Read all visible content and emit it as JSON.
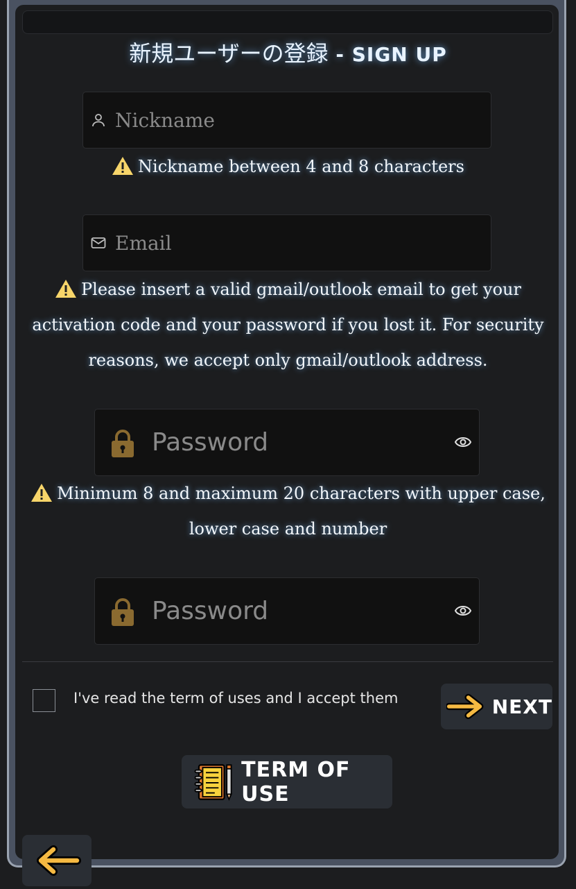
{
  "header": {
    "title_jp": "新規ユーザーの登録",
    "title_sep": " - ",
    "title_en": "SIGN UP"
  },
  "nickname": {
    "placeholder": "Nickname",
    "icon": "user-icon",
    "warning": "Nickname between 4 and 8 characters"
  },
  "email": {
    "placeholder": "Email",
    "icon": "mail-icon",
    "warning_line1": "Please insert a valid gmail/outlook email to get your",
    "warning_line2": "activation code and your password if you lost it. For security",
    "warning_line3": "reasons, we accept only gmail/outlook address."
  },
  "password": {
    "placeholder": "Password",
    "icon": "lock-icon",
    "toggle_icon": "eye-icon",
    "warning_line1": "Minimum 8 and maximum 20 characters with upper case,",
    "warning_line2": "lower case and number"
  },
  "password_confirm": {
    "placeholder": "Password",
    "icon": "lock-icon",
    "toggle_icon": "eye-icon"
  },
  "terms": {
    "accept_label": "I've read the term of uses and I accept them",
    "checked": false
  },
  "buttons": {
    "next_label": "NEXT",
    "term_label": "TERM OF USE",
    "back_icon": "arrow-left-icon"
  },
  "colors": {
    "background": "#1c1d1f",
    "field_bg": "#111111",
    "button_bg": "#2a2e34",
    "warning_yellow": "#f7d56a",
    "arrow_yellow": "#f5b942",
    "lock_gold": "#8a6a30"
  }
}
